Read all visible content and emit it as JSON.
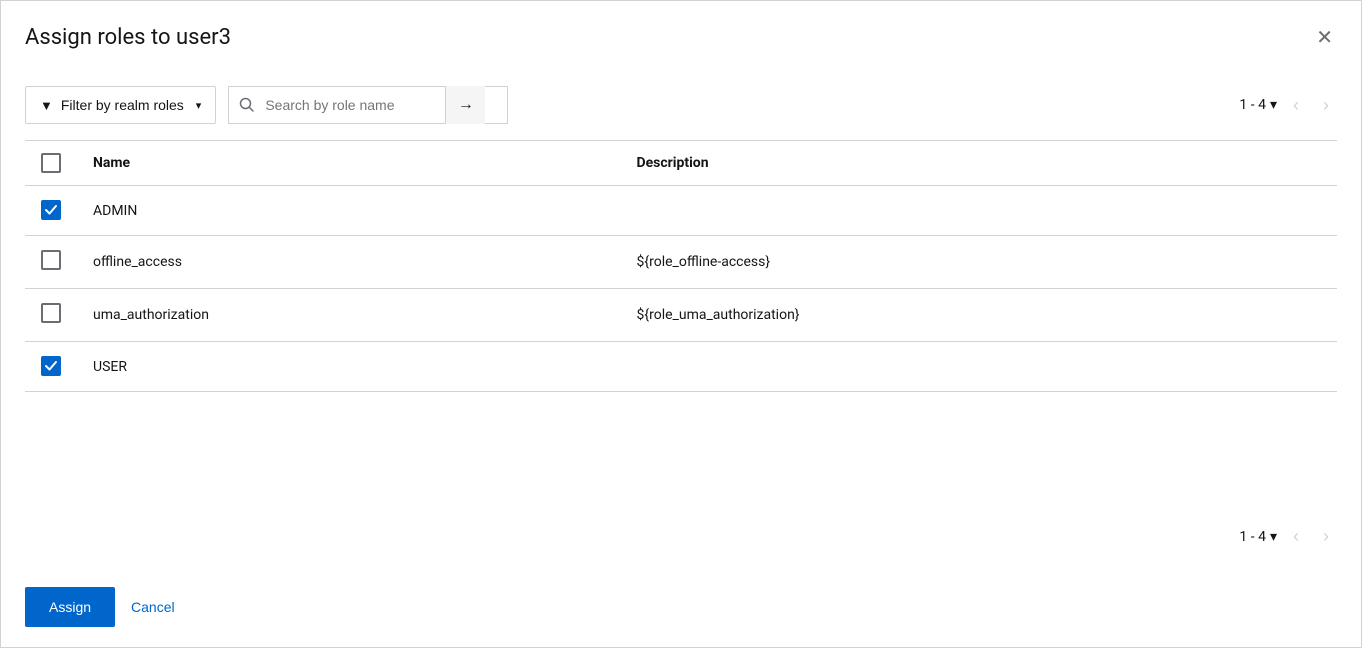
{
  "dialog": {
    "title": "Assign roles to user3",
    "close_label": "×"
  },
  "toolbar": {
    "filter_label": "Filter by realm roles",
    "search_placeholder": "Search by role name",
    "search_go_arrow": "→",
    "pagination": {
      "range": "1 - 4",
      "dropdown_icon": "▾"
    }
  },
  "table": {
    "columns": [
      {
        "id": "checkbox",
        "label": ""
      },
      {
        "id": "name",
        "label": "Name"
      },
      {
        "id": "description",
        "label": "Description"
      }
    ],
    "rows": [
      {
        "id": "row-admin",
        "checked": true,
        "name": "ADMIN",
        "description": ""
      },
      {
        "id": "row-offline",
        "checked": false,
        "name": "offline_access",
        "description": "${role_offline-access}"
      },
      {
        "id": "row-uma",
        "checked": false,
        "name": "uma_authorization",
        "description": "${role_uma_authorization}"
      },
      {
        "id": "row-user",
        "checked": true,
        "name": "USER",
        "description": ""
      }
    ]
  },
  "bottom_pagination": {
    "range": "1 - 4",
    "dropdown_icon": "▾"
  },
  "footer": {
    "assign_label": "Assign",
    "cancel_label": "Cancel"
  },
  "icons": {
    "filter": "⊿",
    "search": "🔍",
    "chevron_left": "‹",
    "chevron_right": "›",
    "check": "✓",
    "close": "✕"
  }
}
